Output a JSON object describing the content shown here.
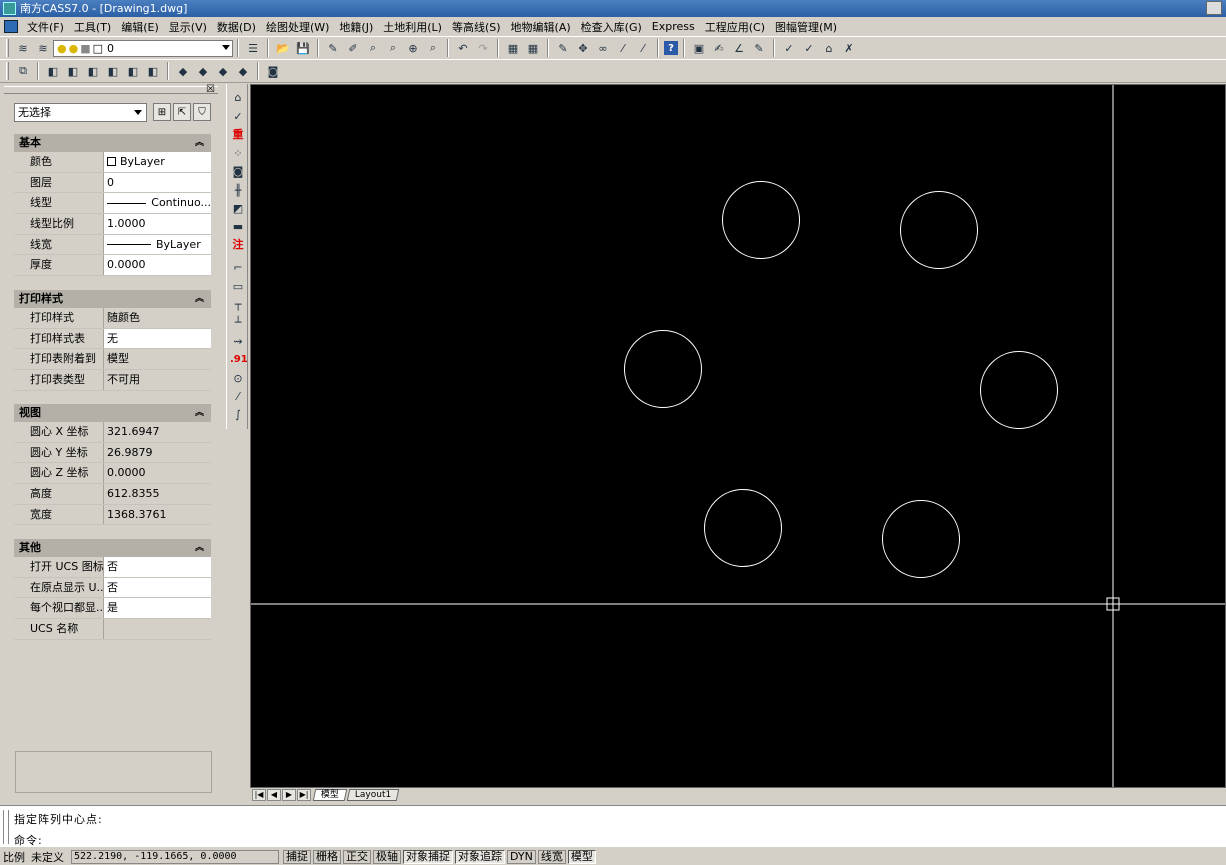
{
  "window": {
    "title": "南方CASS7.0 - [Drawing1.dwg]"
  },
  "menu": [
    "文件(F)",
    "工具(T)",
    "编辑(E)",
    "显示(V)",
    "数据(D)",
    "绘图处理(W)",
    "地籍(J)",
    "土地利用(L)",
    "等高线(S)",
    "地物编辑(A)",
    "检查入库(G)",
    "Express",
    "工程应用(C)",
    "图幅管理(M)"
  ],
  "layer_toolbar": {
    "current_layer": "0"
  },
  "properties": {
    "selection": "无选择",
    "sections": [
      {
        "title": "基本",
        "rows": [
          {
            "key": "颜色",
            "value": "ByLayer",
            "kind": "color"
          },
          {
            "key": "图层",
            "value": "0"
          },
          {
            "key": "线型",
            "value": "Continuo...",
            "kind": "line"
          },
          {
            "key": "线型比例",
            "value": "1.0000"
          },
          {
            "key": "线宽",
            "value": "ByLayer",
            "kind": "line"
          },
          {
            "key": "厚度",
            "value": "0.0000"
          }
        ]
      },
      {
        "title": "打印样式",
        "rows": [
          {
            "key": "打印样式",
            "value": "随颜色"
          },
          {
            "key": "打印样式表",
            "value": "无"
          },
          {
            "key": "打印表附着到",
            "value": "模型"
          },
          {
            "key": "打印表类型",
            "value": "不可用"
          }
        ]
      },
      {
        "title": "视图",
        "rows": [
          {
            "key": "圆心 X 坐标",
            "value": "321.6947"
          },
          {
            "key": "圆心 Y 坐标",
            "value": "26.9879"
          },
          {
            "key": "圆心 Z 坐标",
            "value": "0.0000"
          },
          {
            "key": "高度",
            "value": "612.8355"
          },
          {
            "key": "宽度",
            "value": "1368.3761"
          }
        ]
      },
      {
        "title": "其他",
        "rows": [
          {
            "key": "打开 UCS 图标",
            "value": "否"
          },
          {
            "key": "在原点显示 U...",
            "value": "否"
          },
          {
            "key": "每个视口都显...",
            "value": "是"
          },
          {
            "key": "UCS 名称",
            "value": ""
          }
        ]
      }
    ]
  },
  "side_toolbar_text": {
    "heavy": "重",
    "note": "注",
    "decimal": ".91"
  },
  "tabs": [
    "模型",
    "Layout1"
  ],
  "command": {
    "line1": "指定阵列中心点:",
    "line2": "命令:"
  },
  "status": {
    "scale_label": "比例",
    "scale_value": "未定义",
    "coords": "522.2190, -119.1665, 0.0000",
    "buttons": [
      {
        "label": "捕捉",
        "on": false
      },
      {
        "label": "栅格",
        "on": false
      },
      {
        "label": "正交",
        "on": false
      },
      {
        "label": "极轴",
        "on": false
      },
      {
        "label": "对象捕捉",
        "on": true
      },
      {
        "label": "对象追踪",
        "on": true
      },
      {
        "label": "DYN",
        "on": false
      },
      {
        "label": "线宽",
        "on": false
      },
      {
        "label": "模型",
        "on": true
      }
    ]
  },
  "colors": {
    "canvas": "#000000",
    "drawing": "#ffffff",
    "chrome": "#d4d0c8",
    "titlebar": "#2c5fa5"
  }
}
